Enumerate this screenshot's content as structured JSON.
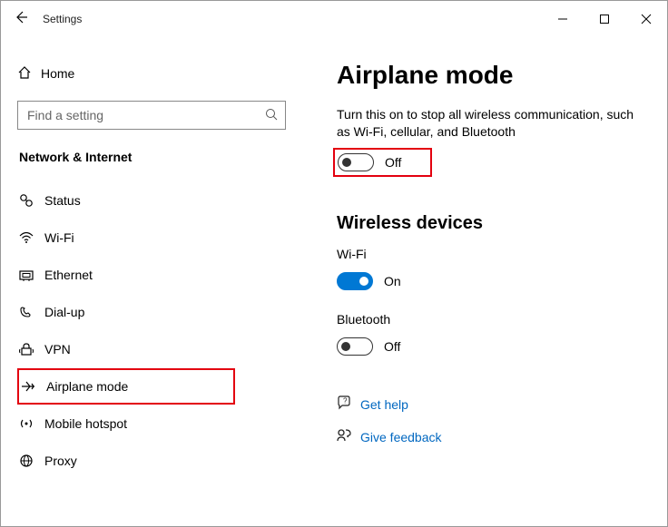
{
  "window": {
    "title": "Settings"
  },
  "sidebar": {
    "home_label": "Home",
    "search_placeholder": "Find a setting",
    "category": "Network & Internet",
    "items": [
      {
        "label": "Status"
      },
      {
        "label": "Wi-Fi"
      },
      {
        "label": "Ethernet"
      },
      {
        "label": "Dial-up"
      },
      {
        "label": "VPN"
      },
      {
        "label": "Airplane mode"
      },
      {
        "label": "Mobile hotspot"
      },
      {
        "label": "Proxy"
      }
    ]
  },
  "main": {
    "title": "Airplane mode",
    "description": "Turn this on to stop all wireless communication, such as Wi-Fi, cellular, and Bluetooth",
    "airplane_toggle": {
      "state": "Off"
    },
    "wireless_header": "Wireless devices",
    "wifi": {
      "label": "Wi-Fi",
      "state": "On"
    },
    "bluetooth": {
      "label": "Bluetooth",
      "state": "Off"
    },
    "links": {
      "help": "Get help",
      "feedback": "Give feedback"
    }
  }
}
